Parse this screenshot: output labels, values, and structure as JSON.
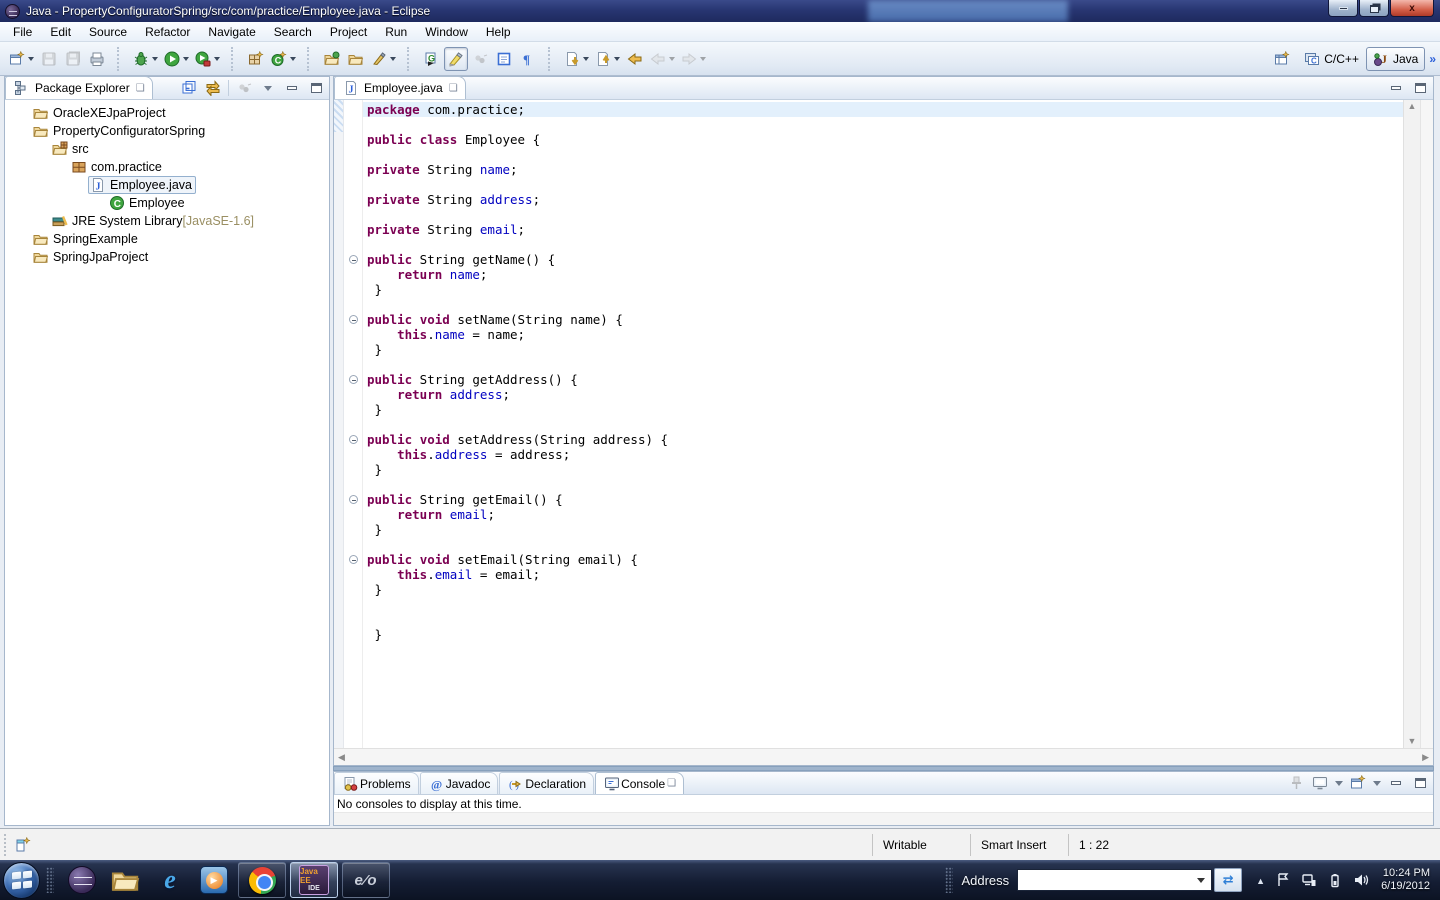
{
  "window": {
    "title": "Java - PropertyConfiguratorSpring/src/com/practice/Employee.java - Eclipse",
    "controls": {
      "minimize": "minimize",
      "restore": "restore",
      "close": "close"
    }
  },
  "menu": {
    "items": [
      "File",
      "Edit",
      "Source",
      "Refactor",
      "Navigate",
      "Search",
      "Project",
      "Run",
      "Window",
      "Help"
    ]
  },
  "toolbar": {
    "groups": [
      [
        {
          "ic": "new-wizard",
          "dd": true
        },
        {
          "ic": "save",
          "dis": true
        },
        {
          "ic": "save-all",
          "dis": true
        },
        {
          "ic": "print"
        }
      ],
      [
        {
          "ic": "debug",
          "dd": true
        },
        {
          "ic": "run",
          "dd": true
        },
        {
          "ic": "run-external",
          "dd": true
        }
      ],
      [
        {
          "ic": "new-java-project"
        },
        {
          "ic": "new-class",
          "dd": true
        }
      ],
      [
        {
          "ic": "open-type"
        },
        {
          "ic": "open-resource"
        },
        {
          "ic": "search-pen",
          "dd": true
        }
      ],
      [
        {
          "ic": "generate"
        },
        {
          "ic": "mark-occurrences",
          "pressed": true
        },
        {
          "ic": "gray-dots",
          "dis": true
        },
        {
          "ic": "show-source"
        },
        {
          "ic": "show-whitespace"
        }
      ],
      [
        {
          "ic": "next-annotation",
          "dd": true
        },
        {
          "ic": "prev-annotation",
          "dd": true
        },
        {
          "ic": "last-edit"
        },
        {
          "ic": "back",
          "dis": true,
          "dd": true
        },
        {
          "ic": "forward",
          "dis": true,
          "dd": true
        }
      ]
    ]
  },
  "perspective": {
    "open_label": "",
    "cpp_label": "C/C++",
    "java_label": "Java",
    "more": "»"
  },
  "package_explorer": {
    "title": "Package Explorer",
    "tree": [
      {
        "depth": 0,
        "icon": "project",
        "label": "OracleXEJpaProject"
      },
      {
        "depth": 0,
        "icon": "project",
        "label": "PropertyConfiguratorSpring"
      },
      {
        "depth": 1,
        "icon": "src-folder",
        "label": "src"
      },
      {
        "depth": 2,
        "icon": "package",
        "label": "com.practice"
      },
      {
        "depth": 3,
        "icon": "java-file",
        "label": "Employee.java",
        "selected": true
      },
      {
        "depth": 4,
        "icon": "class",
        "label": "Employee"
      },
      {
        "depth": 1,
        "icon": "library",
        "label": "JRE System Library",
        "suffix": " [JavaSE-1.6]"
      },
      {
        "depth": 0,
        "icon": "project",
        "label": "SpringExample"
      },
      {
        "depth": 0,
        "icon": "project",
        "label": "SpringJpaProject"
      }
    ]
  },
  "editor": {
    "tab_label": "Employee.java",
    "syntax_colors": {
      "keyword": "#7B0052",
      "field": "#0000C0",
      "plain": "#000000",
      "current_line": "#E3F0FC"
    },
    "lines": [
      {
        "h": 1,
        "s": [
          [
            "k",
            "package"
          ],
          [
            "p",
            " com.practice;"
          ]
        ]
      },
      {
        "s": []
      },
      {
        "s": [
          [
            "k",
            "public"
          ],
          [
            "p",
            " "
          ],
          [
            "k",
            "class"
          ],
          [
            "p",
            " Employee {"
          ]
        ]
      },
      {
        "s": []
      },
      {
        "s": [
          [
            "k",
            "private"
          ],
          [
            "p",
            " String "
          ],
          [
            "v",
            "name"
          ],
          [
            "p",
            ";"
          ]
        ]
      },
      {
        "s": []
      },
      {
        "s": [
          [
            "k",
            "private"
          ],
          [
            "p",
            " String "
          ],
          [
            "v",
            "address"
          ],
          [
            "p",
            ";"
          ]
        ]
      },
      {
        "s": []
      },
      {
        "s": [
          [
            "k",
            "private"
          ],
          [
            "p",
            " String "
          ],
          [
            "v",
            "email"
          ],
          [
            "p",
            ";"
          ]
        ]
      },
      {
        "s": []
      },
      {
        "f": 1,
        "s": [
          [
            "k",
            "public"
          ],
          [
            "p",
            " String getName() {"
          ]
        ]
      },
      {
        "s": [
          [
            "p",
            "    "
          ],
          [
            "k",
            "return"
          ],
          [
            "p",
            " "
          ],
          [
            "v",
            "name"
          ],
          [
            "p",
            ";"
          ]
        ]
      },
      {
        "s": [
          [
            "p",
            " }"
          ]
        ]
      },
      {
        "s": []
      },
      {
        "f": 1,
        "s": [
          [
            "k",
            "public"
          ],
          [
            "p",
            " "
          ],
          [
            "k",
            "void"
          ],
          [
            "p",
            " setName(String name) {"
          ]
        ]
      },
      {
        "s": [
          [
            "p",
            "    "
          ],
          [
            "k",
            "this"
          ],
          [
            "p",
            "."
          ],
          [
            "v",
            "name"
          ],
          [
            "p",
            " = name;"
          ]
        ]
      },
      {
        "s": [
          [
            "p",
            " }"
          ]
        ]
      },
      {
        "s": []
      },
      {
        "f": 1,
        "s": [
          [
            "k",
            "public"
          ],
          [
            "p",
            " String getAddress() {"
          ]
        ]
      },
      {
        "s": [
          [
            "p",
            "    "
          ],
          [
            "k",
            "return"
          ],
          [
            "p",
            " "
          ],
          [
            "v",
            "address"
          ],
          [
            "p",
            ";"
          ]
        ]
      },
      {
        "s": [
          [
            "p",
            " }"
          ]
        ]
      },
      {
        "s": []
      },
      {
        "f": 1,
        "s": [
          [
            "k",
            "public"
          ],
          [
            "p",
            " "
          ],
          [
            "k",
            "void"
          ],
          [
            "p",
            " setAddress(String address) {"
          ]
        ]
      },
      {
        "s": [
          [
            "p",
            "    "
          ],
          [
            "k",
            "this"
          ],
          [
            "p",
            "."
          ],
          [
            "v",
            "address"
          ],
          [
            "p",
            " = address;"
          ]
        ]
      },
      {
        "s": [
          [
            "p",
            " }"
          ]
        ]
      },
      {
        "s": []
      },
      {
        "f": 1,
        "s": [
          [
            "k",
            "public"
          ],
          [
            "p",
            " String getEmail() {"
          ]
        ]
      },
      {
        "s": [
          [
            "p",
            "    "
          ],
          [
            "k",
            "return"
          ],
          [
            "p",
            " "
          ],
          [
            "v",
            "email"
          ],
          [
            "p",
            ";"
          ]
        ]
      },
      {
        "s": [
          [
            "p",
            " }"
          ]
        ]
      },
      {
        "s": []
      },
      {
        "f": 1,
        "s": [
          [
            "k",
            "public"
          ],
          [
            "p",
            " "
          ],
          [
            "k",
            "void"
          ],
          [
            "p",
            " setEmail(String email) {"
          ]
        ]
      },
      {
        "s": [
          [
            "p",
            "    "
          ],
          [
            "k",
            "this"
          ],
          [
            "p",
            "."
          ],
          [
            "v",
            "email"
          ],
          [
            "p",
            " = email;"
          ]
        ]
      },
      {
        "s": [
          [
            "p",
            " }"
          ]
        ]
      },
      {
        "s": []
      },
      {
        "s": []
      },
      {
        "s": [
          [
            "p",
            " }"
          ]
        ]
      }
    ]
  },
  "console_view": {
    "tabs": [
      {
        "icon": "problems",
        "label": "Problems"
      },
      {
        "icon": "javadoc",
        "label": "Javadoc"
      },
      {
        "icon": "declaration",
        "label": "Declaration"
      },
      {
        "icon": "console",
        "label": "Console",
        "active": true,
        "closable": true
      }
    ],
    "message": "No consoles to display at this time."
  },
  "statusbar": {
    "writable": "Writable",
    "insert_mode": "Smart Insert",
    "position": "1 : 22"
  },
  "taskbar": {
    "address_label": "Address",
    "address_value": "",
    "clock_time": "10:24 PM",
    "clock_date": "6/19/2012",
    "apps": [
      {
        "name": "eclipse",
        "kind": "icon"
      },
      {
        "name": "explorer",
        "kind": "icon"
      },
      {
        "name": "internet-explorer",
        "kind": "icon"
      },
      {
        "name": "media-player",
        "kind": "icon"
      },
      {
        "name": "chrome",
        "kind": "button"
      },
      {
        "name": "java-ee-ide",
        "kind": "button",
        "foreground": true
      },
      {
        "name": "evo",
        "kind": "button"
      }
    ],
    "tray": [
      "hidden-icons",
      "action-center-flag",
      "network",
      "battery",
      "volume"
    ]
  }
}
